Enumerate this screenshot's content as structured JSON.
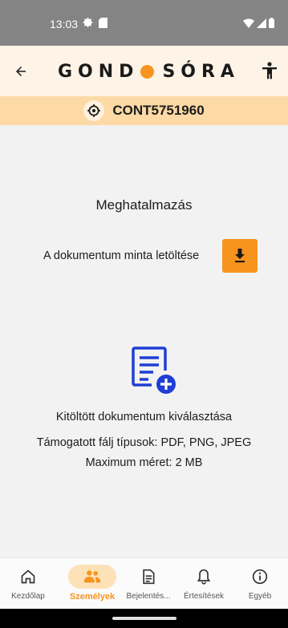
{
  "status_bar": {
    "time": "13:03",
    "left_icons": [
      "settings-icon",
      "sd-card-icon"
    ],
    "right_icons": [
      "wifi-icon",
      "signal-icon",
      "battery-icon"
    ]
  },
  "header": {
    "back_icon": "arrow-left-icon",
    "brand_part1": "GOND",
    "brand_part2": "SÓRA",
    "accessibility_icon": "accessibility-icon"
  },
  "contract": {
    "icon": "target-icon",
    "id": "CONT5751960"
  },
  "main": {
    "section_title": "Meghatalmazás",
    "download_label": "A dokumentum minta letöltése",
    "download_icon": "download-icon",
    "upload_icon": "document-add-icon",
    "upload_title": "Kitöltött dokumentum kiválasztása",
    "supported_types": "Támogatott fálj típusok: PDF, PNG, JPEG",
    "max_size": "Maximum méret: 2 MB"
  },
  "bottom_nav": {
    "items": [
      {
        "label": "Kezdőlap",
        "icon": "home-icon",
        "active": false
      },
      {
        "label": "Személyek",
        "icon": "people-icon",
        "active": true
      },
      {
        "label": "Bejelentés...",
        "icon": "document-icon",
        "active": false
      },
      {
        "label": "Értesítések",
        "icon": "bell-icon",
        "active": false
      },
      {
        "label": "Egyéb",
        "icon": "info-icon",
        "active": false
      }
    ]
  },
  "colors": {
    "accent": "#f7941d",
    "contract_bar": "#fcd9a5",
    "header_bg": "#fdf3e7",
    "icon_blue": "#1f3ed6"
  }
}
